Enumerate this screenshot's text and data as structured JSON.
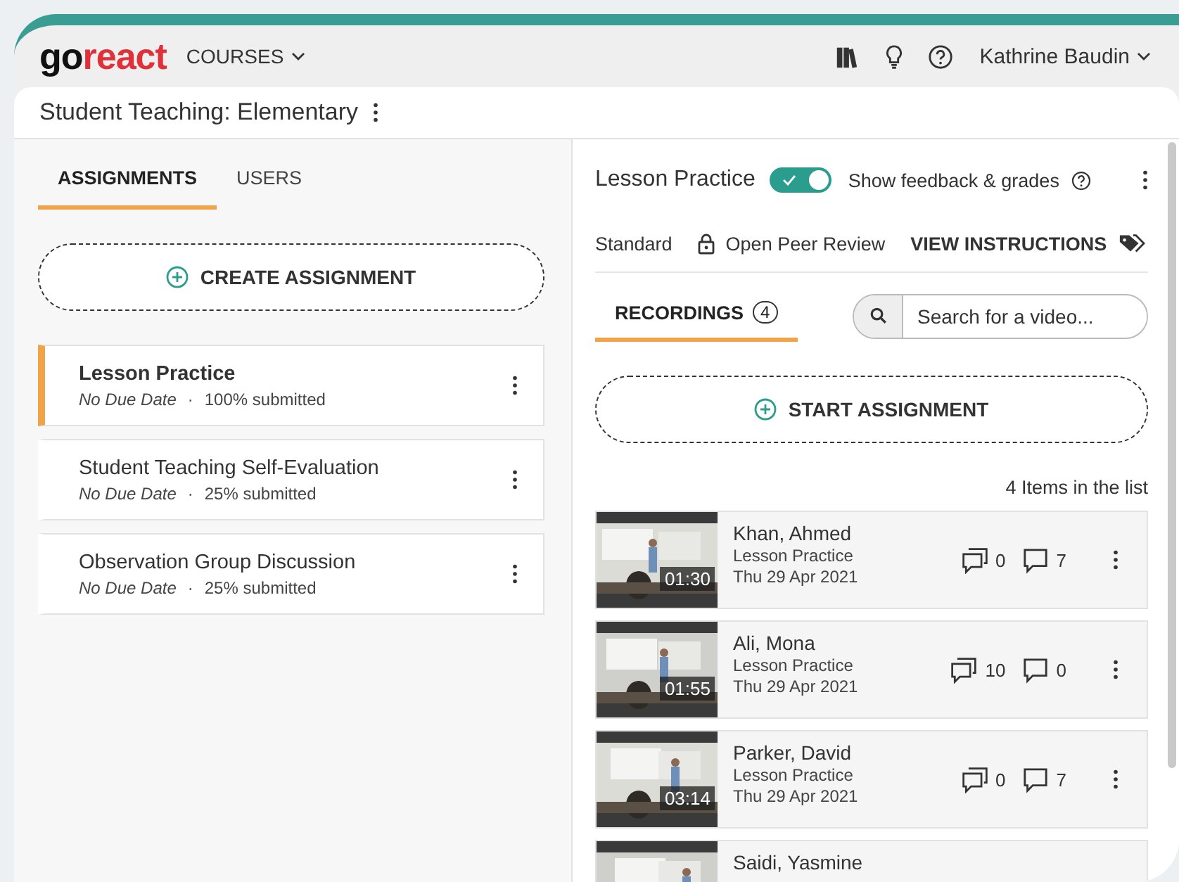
{
  "header": {
    "logo": {
      "prefix": "go",
      "suffix": "react"
    },
    "courses_menu": "COURSES",
    "user_menu": "Kathrine Baudin"
  },
  "course": {
    "title": "Student Teaching: Elementary"
  },
  "left_tabs": [
    {
      "label": "ASSIGNMENTS",
      "selected": true
    },
    {
      "label": "USERS",
      "selected": false
    }
  ],
  "create_button": "CREATE ASSIGNMENT",
  "assignments": [
    {
      "title": "Lesson Practice",
      "due": "No Due Date",
      "separator": "·",
      "submitted": "100% submitted",
      "selected": true
    },
    {
      "title": "Student Teaching Self-Evaluation",
      "due": "No Due Date",
      "separator": "·",
      "submitted": "25% submitted",
      "selected": false
    },
    {
      "title": "Observation Group Discussion",
      "due": "No Due Date",
      "separator": "·",
      "submitted": "25% submitted",
      "selected": false
    }
  ],
  "assignment_detail": {
    "title": "Lesson Practice",
    "feedback_toggle": {
      "on": true,
      "label": "Show feedback & grades"
    },
    "type": "Standard",
    "peer_review": "Open Peer Review",
    "instructions_link": "VIEW INSTRUCTIONS"
  },
  "recordings_tab": {
    "label": "RECORDINGS",
    "count": "4",
    "selected": true
  },
  "search": {
    "placeholder": "Search for a video..."
  },
  "start_button": "START ASSIGNMENT",
  "items_count": "4 Items in the list",
  "recordings": [
    {
      "name": "Khan, Ahmed",
      "assignment": "Lesson Practice",
      "date": "Thu 29 Apr 2021",
      "duration": "01:30",
      "threads": "0",
      "comments": "7"
    },
    {
      "name": "Ali, Mona",
      "assignment": "Lesson Practice",
      "date": "Thu 29 Apr 2021",
      "duration": "01:55",
      "threads": "10",
      "comments": "0"
    },
    {
      "name": "Parker, David",
      "assignment": "Lesson Practice",
      "date": "Thu 29 Apr 2021",
      "duration": "03:14",
      "threads": "0",
      "comments": "7"
    },
    {
      "name": "Saidi, Yasmine"
    }
  ]
}
